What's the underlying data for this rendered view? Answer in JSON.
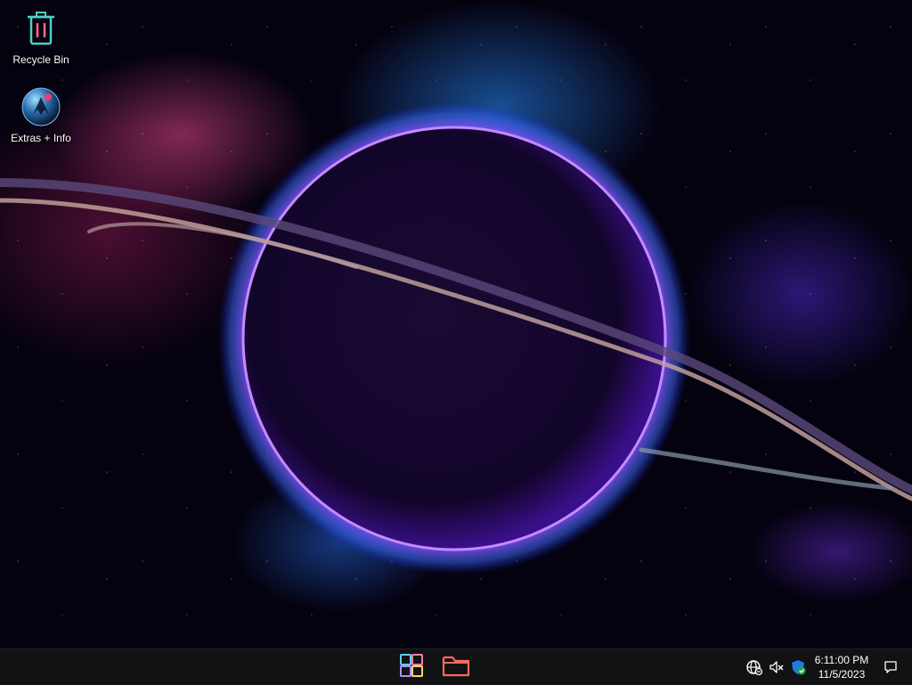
{
  "desktop": {
    "wallpaper": "space-planet-with-rings",
    "accent_purple": "#7b2cff",
    "accent_blue": "#2a8cff",
    "icons": [
      {
        "label": "Recycle Bin",
        "icon": "recycle-bin-icon"
      },
      {
        "label": "Extras + Info",
        "icon": "extras-info-icon"
      }
    ]
  },
  "taskbar": {
    "pinned": [
      {
        "name": "start",
        "icon": "windows-start-icon"
      },
      {
        "name": "file-explorer",
        "icon": "folder-icon"
      }
    ],
    "tray": {
      "icons": [
        "network-globe-icon",
        "speaker-muted-icon",
        "defender-shield-icon"
      ],
      "time": "6:11:00 PM",
      "date": "11/5/2023",
      "notification_icon": "notification-icon"
    },
    "background": "#101214"
  }
}
